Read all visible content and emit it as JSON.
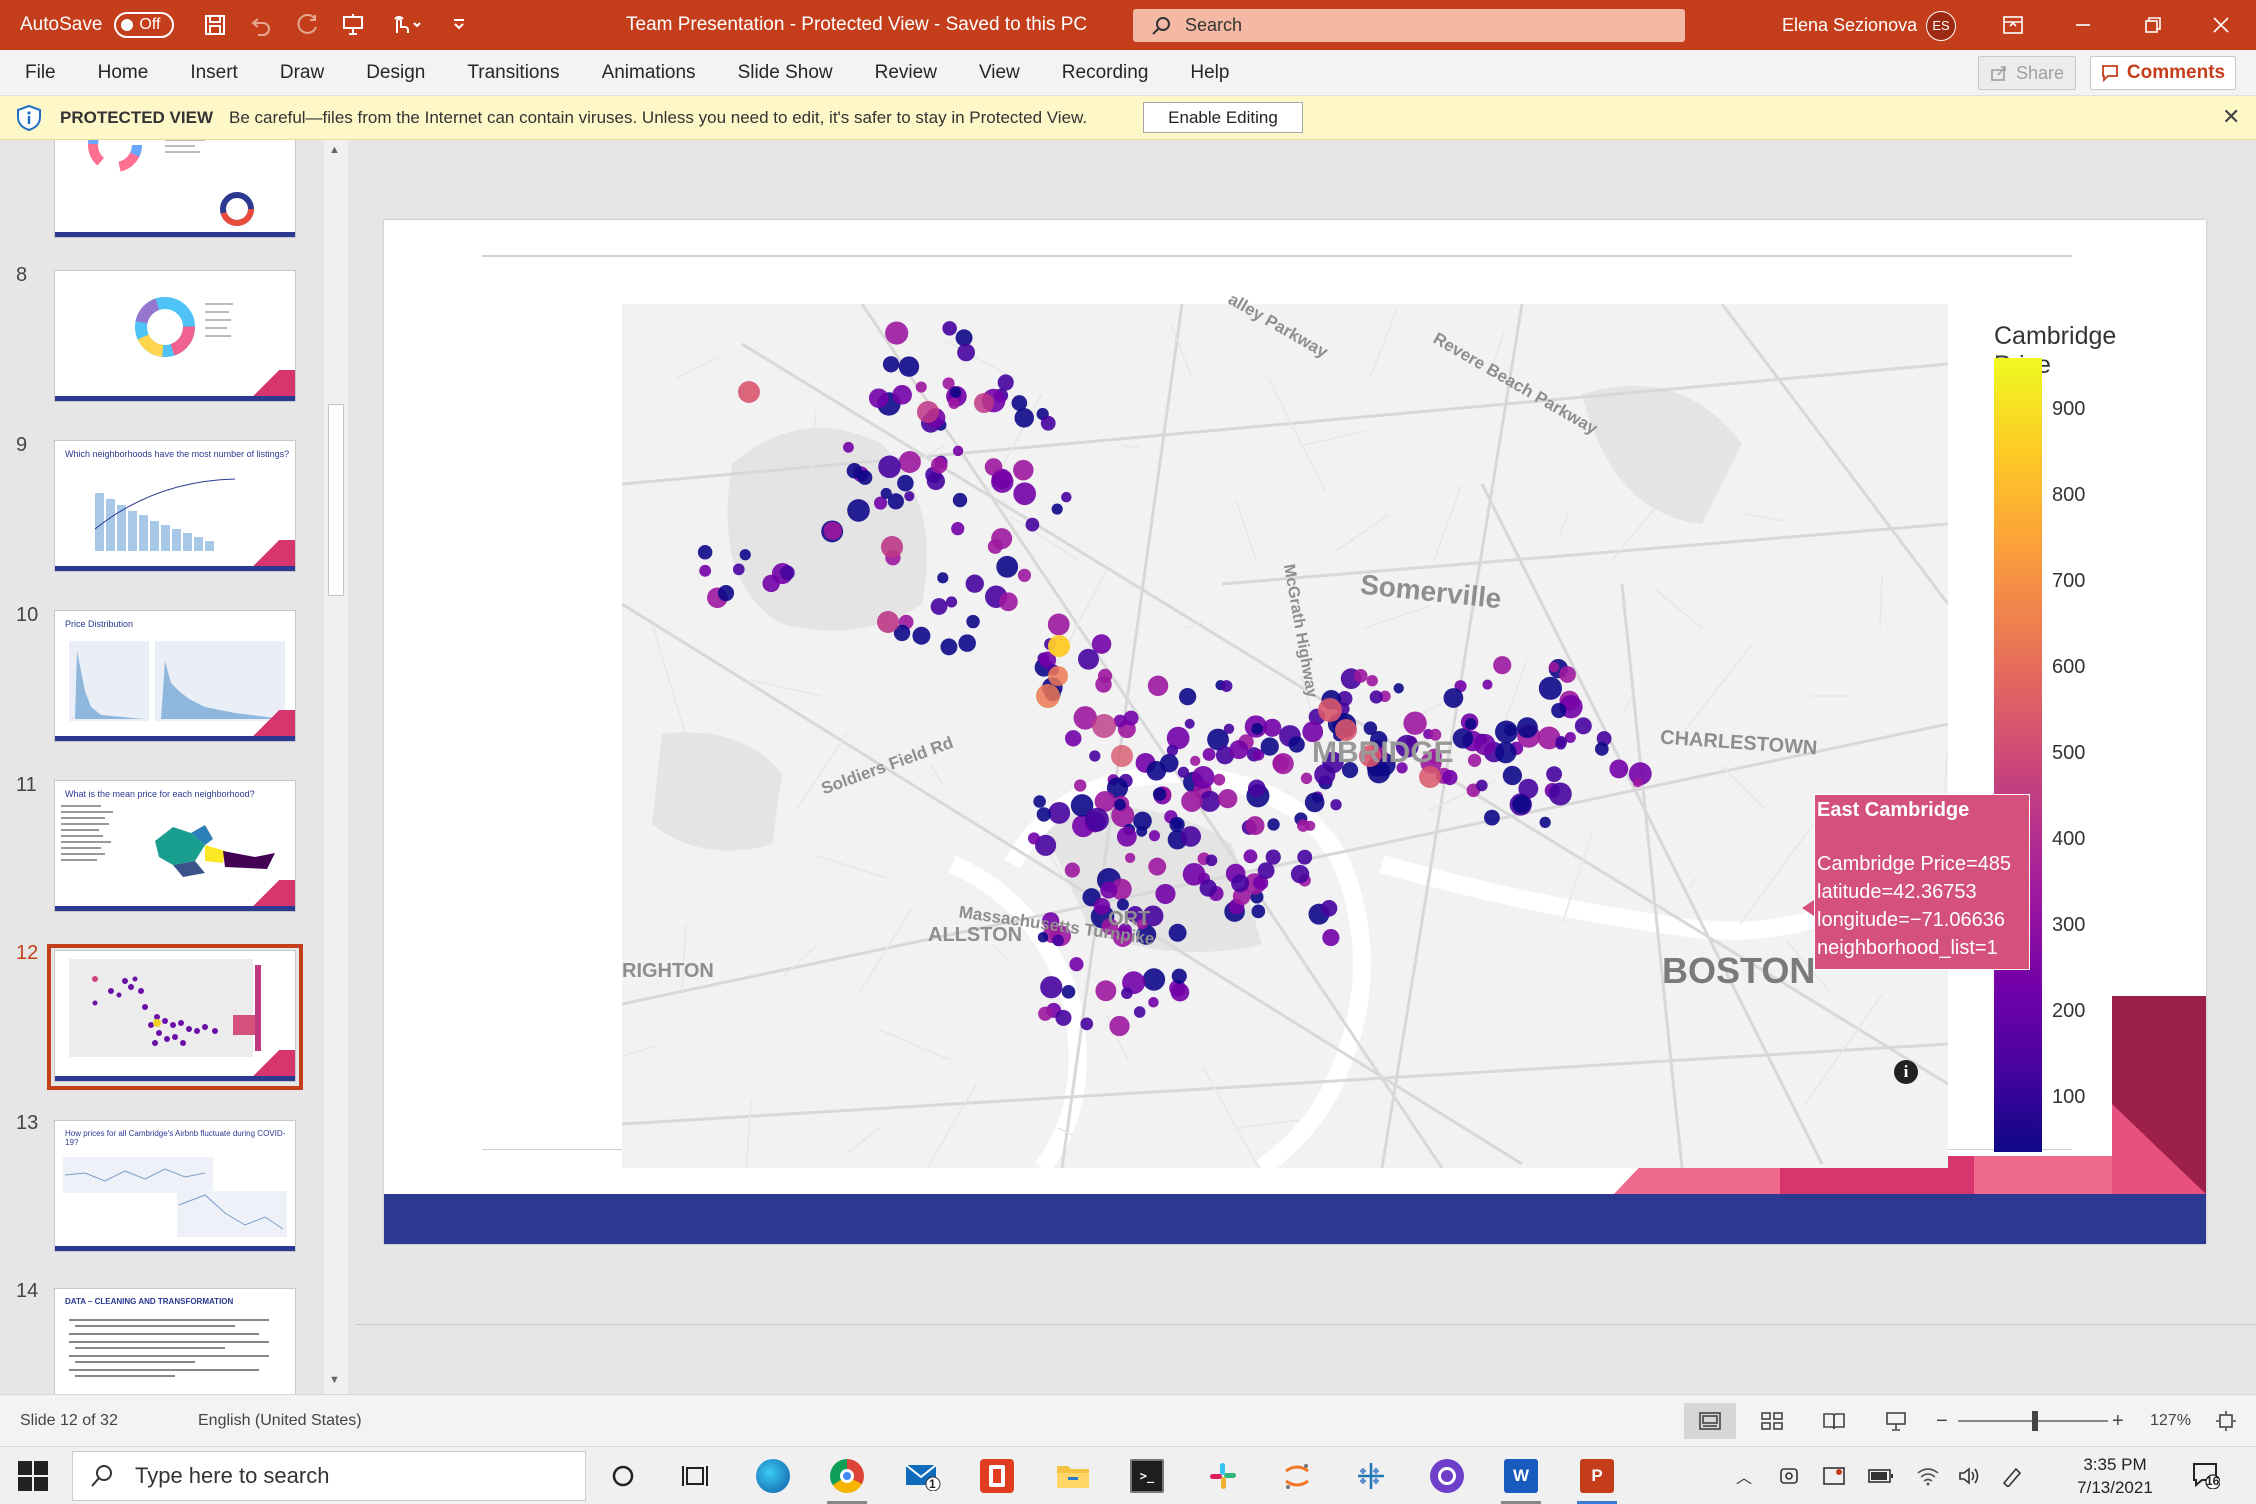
{
  "titlebar": {
    "autosave_label": "AutoSave",
    "autosave_state": "Off",
    "doc_title": "Team Presentation  -  Protected View  -  Saved to this PC",
    "search_placeholder": "Search",
    "user_name": "Elena Sezionova",
    "user_initials": "ES"
  },
  "ribbon": {
    "tabs": [
      "File",
      "Home",
      "Insert",
      "Draw",
      "Design",
      "Transitions",
      "Animations",
      "Slide Show",
      "Review",
      "View",
      "Recording",
      "Help"
    ],
    "share_label": "Share",
    "comments_label": "Comments"
  },
  "protected_view": {
    "title": "PROTECTED VIEW",
    "message": "Be careful—files from the Internet can contain viruses. Unless you need to edit, it's safer to stay in Protected View.",
    "button": "Enable Editing"
  },
  "thumbnails": [
    {
      "number": "",
      "title": ""
    },
    {
      "number": "8",
      "title": ""
    },
    {
      "number": "9",
      "title": "Which neighborhoods have the most number of listings?"
    },
    {
      "number": "10",
      "title": "Price Distribution"
    },
    {
      "number": "11",
      "title": "What is the mean price for each neighborhood?"
    },
    {
      "number": "12",
      "title": ""
    },
    {
      "number": "13",
      "title": "How prices for all Cambridge's Airbnb fluctuate during COVID-19?"
    },
    {
      "number": "14",
      "title": "DATA – CLEANING AND TRANSFORMATION"
    }
  ],
  "active_slide": "12",
  "map": {
    "labels": [
      "Somerville",
      "CHARLESTOWN",
      "MBRIDGE",
      "ALLSTON",
      "BOSTON",
      "RIGHTON",
      "Soldiers Field Rd",
      "Massachusetts Turnpike",
      "McGrath Highway",
      "Revere Beach Parkway",
      "alley Parkway",
      "ORT"
    ],
    "colorbar_title": "Cambridge Price",
    "colorbar_ticks": [
      "900",
      "800",
      "700",
      "600",
      "500",
      "400",
      "300",
      "200",
      "100"
    ],
    "tooltip": {
      "title": "East Cambridge",
      "lines": [
        "Cambridge Price=485",
        "latitude=42.36753",
        "longitude=−71.06636",
        "neighborhood_list=1"
      ]
    }
  },
  "chart_data": {
    "type": "scatter",
    "title": "",
    "colorbar_title": "Cambridge Price",
    "colorbar_range": [
      0,
      960
    ],
    "colorbar_ticks": [
      100,
      200,
      300,
      400,
      500,
      600,
      700,
      800,
      900
    ],
    "colorscale": [
      "#0d0887",
      "#46039f",
      "#7201a8",
      "#9c179e",
      "#bd3786",
      "#d8576b",
      "#ed7953",
      "#fb9f3a",
      "#fdca26",
      "#f0f921"
    ],
    "hovered_point": {
      "neighborhood": "East Cambridge",
      "price": 485,
      "latitude": 42.36753,
      "longitude": -71.06636,
      "neighborhood_list": 1
    }
  },
  "statusbar": {
    "slide_info": "Slide 12 of 32",
    "language": "English (United States)",
    "zoom_minus": "−",
    "zoom_plus": "+",
    "zoom": "127%"
  },
  "taskbar": {
    "search_placeholder": "Type here to search",
    "time": "3:35 PM",
    "date": "7/13/2021",
    "mail_badge": "1",
    "notification_count": "16"
  }
}
